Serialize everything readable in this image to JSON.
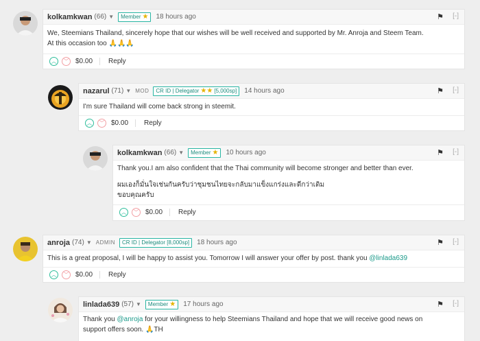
{
  "comments": [
    {
      "author": "kolkamkwan",
      "rep": "(66)",
      "role": "",
      "badge": "Member",
      "badge_stars": "★",
      "time": "18 hours ago",
      "lines": [
        "We, Steemians Thailand, sincerely hope that our wishes will be well received and supported by Mr. Anroja and Steem Team.",
        "At this occasion too 🙏🙏🙏"
      ],
      "payout": "$0.00",
      "reply": "Reply"
    },
    {
      "author": "nazarul",
      "rep": "(71)",
      "role": "MOD",
      "badge": "CR ID | Delegator",
      "badge_stars": "★★",
      "badge_sp": "[5,000sp]",
      "time": "14 hours ago",
      "lines": [
        "I'm sure Thailand will come back strong in steemit."
      ],
      "payout": "$0.00",
      "reply": "Reply"
    },
    {
      "author": "kolkamkwan",
      "rep": "(66)",
      "role": "",
      "badge": "Member",
      "badge_stars": "★",
      "time": "10 hours ago",
      "lines": [
        "Thank you.I am also confident that the Thai community will become stronger and better than ever.",
        "ผมเองก็มั่นใจเช่นกันครับว่าชุมชนไทยจะกลับมาแข็งแกร่งและดีกว่าเดิม",
        "ขอบคุณครับ"
      ],
      "payout": "$0.00",
      "reply": "Reply"
    },
    {
      "author": "anroja",
      "rep": "(74)",
      "role": "ADMIN",
      "badge": "CR ID | Delegator [8,000sp]",
      "badge_stars": "",
      "time": "18 hours ago",
      "lines_prefix": "This is a great proposal, I will be happy to assist you. Tomorrow I will answer your offer by post. thank you ",
      "lines_link": "@linlada639",
      "payout": "$0.00",
      "reply": "Reply"
    },
    {
      "author": "linlada639",
      "rep": "(57)",
      "role": "",
      "badge": "Member",
      "badge_stars": "★",
      "time": "17 hours ago",
      "text_a": "Thank you ",
      "link": "@anroja",
      "text_b": " for your willingness to help Steemians Thailand and hope that we will receive good news on",
      "line2": "support offers soon. 🙏TH"
    }
  ],
  "icons": {
    "flag": "flag-icon",
    "collapse": "[-]",
    "upvote": "chevron-up-icon",
    "downvote": "chevron-down-icon"
  },
  "colors": {
    "accent": "#1b9a8a",
    "upvote": "#2dbd9a",
    "downvote": "#f28a90",
    "star": "#e5b300"
  }
}
